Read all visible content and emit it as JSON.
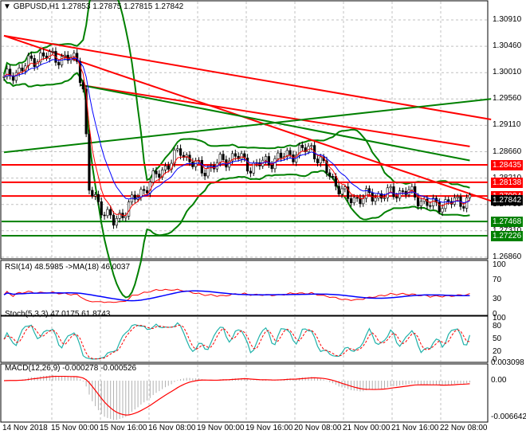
{
  "header": {
    "symbol": "GBPUSD,H1",
    "open": "1.27853",
    "high": "1.27875",
    "low": "1.27815",
    "close": "1.27842"
  },
  "price_axis": [
    "1.30910",
    "1.30460",
    "1.30010",
    "1.29560",
    "1.29110",
    "1.28660",
    "1.28210",
    "1.27760",
    "1.27310",
    "1.26860"
  ],
  "levels": [
    {
      "value": "1.28435",
      "color": "#ff0000"
    },
    {
      "value": "1.28138",
      "color": "#ff0000"
    },
    {
      "value": "1.27904",
      "color": "#ff0000"
    },
    {
      "value": "1.27468",
      "color": "#008000"
    },
    {
      "value": "1.27226",
      "color": "#008000"
    }
  ],
  "current_price": "1.27842",
  "rsi": {
    "label": "RSI(14) 48.5985  ->MA(18) 46.0037",
    "ticks": [
      "100",
      "70",
      "30",
      "0"
    ]
  },
  "stoch": {
    "label": "Stoch(5,3,3) 47.0175 61.8743",
    "ticks": [
      "100",
      "80",
      "50",
      "20",
      "0"
    ]
  },
  "macd": {
    "label": "MACD(12,26,9) -0.000278 -0.000526",
    "ticks": [
      "0.003098",
      "0.00",
      "-0.006642"
    ]
  },
  "time_axis": [
    "14 Nov 2018",
    "15 Nov 00:00",
    "15 Nov 16:00",
    "16 Nov 08:00",
    "19 Nov 00:00",
    "19 Nov 16:00",
    "20 Nov 08:00",
    "21 Nov 00:00",
    "21 Nov 16:00",
    "22 Nov 08:00"
  ],
  "chart_data": {
    "type": "candlestick",
    "anchors": [
      [
        0,
        1.2989
      ],
      [
        12,
        1.303
      ],
      [
        24,
        1.3023
      ],
      [
        26,
        1.2975
      ],
      [
        28,
        1.2799
      ],
      [
        36,
        1.2744
      ],
      [
        44,
        1.2792
      ],
      [
        58,
        1.2867
      ],
      [
        65,
        1.2833
      ],
      [
        76,
        1.286
      ],
      [
        81,
        1.284
      ],
      [
        89,
        1.2853
      ],
      [
        101,
        1.2873
      ],
      [
        105,
        1.284
      ],
      [
        113,
        1.2785
      ],
      [
        124,
        1.2792
      ],
      [
        132,
        1.2799
      ],
      [
        140,
        1.2774
      ],
      [
        153,
        1.2784
      ]
    ],
    "trendlines": [
      {
        "from": [
          0,
          1.3064
        ],
        "to": [
          160,
          1.2921
        ],
        "color": "#ff0000"
      },
      {
        "from": [
          0,
          1.3064
        ],
        "to": [
          160,
          1.2782
        ],
        "color": "#ff0000"
      },
      {
        "from": [
          25,
          1.298
        ],
        "to": [
          153,
          1.2875
        ],
        "color": "#ff0000"
      },
      {
        "from": [
          25,
          1.298
        ],
        "to": [
          153,
          1.2851
        ],
        "color": "#008000"
      },
      {
        "from": [
          0,
          1.2865
        ],
        "to": [
          160,
          1.2956
        ],
        "color": "#008000"
      }
    ]
  }
}
